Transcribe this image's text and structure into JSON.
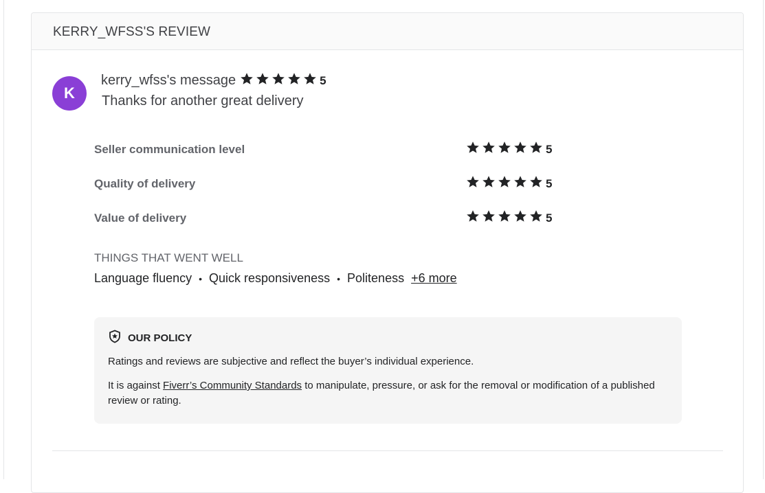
{
  "header": {
    "title": "KERRY_WFSS'S REVIEW"
  },
  "avatar": {
    "initial": "K",
    "color": "#8a3fd6"
  },
  "message": {
    "title": "kerry_wfss's message",
    "rating": 5,
    "rating_label": "5",
    "body": "Thanks for another great delivery"
  },
  "ratings": [
    {
      "label": "Seller communication level",
      "value": 5,
      "value_label": "5"
    },
    {
      "label": "Quality of delivery",
      "value": 5,
      "value_label": "5"
    },
    {
      "label": "Value of delivery",
      "value": 5,
      "value_label": "5"
    }
  ],
  "things": {
    "title": "THINGS THAT WENT WELL",
    "items": [
      "Language fluency",
      "Quick responsiveness",
      "Politeness"
    ],
    "more_label": "+6 more"
  },
  "policy": {
    "title": "OUR POLICY",
    "icon": "shield-star-icon",
    "paragraph1": "Ratings and reviews are subjective and reflect the buyer’s individual experience.",
    "paragraph2_prefix": "It is against ",
    "paragraph2_link": "Fiverr’s Community Standards",
    "paragraph2_suffix": " to manipulate, pressure, or ask for the removal or modification of a published review or rating."
  }
}
